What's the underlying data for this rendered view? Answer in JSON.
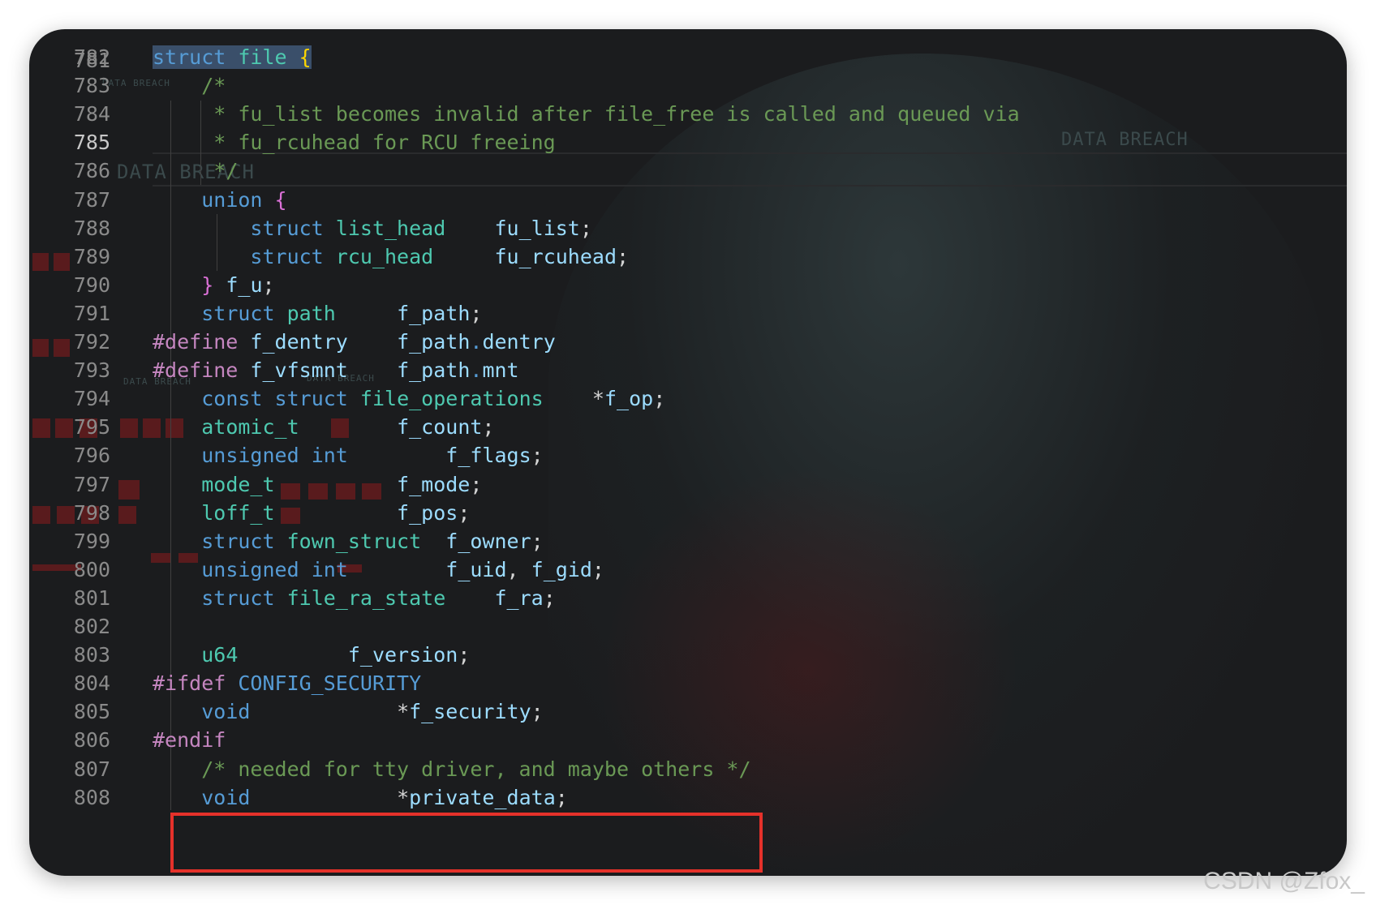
{
  "editor": {
    "partial_top_line": "781",
    "current_line": "785",
    "lines": [
      {
        "n": "782",
        "tokens": [
          [
            "kw sel",
            "struct"
          ],
          [
            "sel",
            " "
          ],
          [
            "ty sel",
            "file"
          ],
          [
            "sel",
            " "
          ],
          [
            "br sel",
            "{"
          ]
        ]
      },
      {
        "n": "783",
        "tokens": [
          [
            "",
            "    "
          ],
          [
            "cm",
            "/*"
          ]
        ]
      },
      {
        "n": "784",
        "tokens": [
          [
            "",
            "     "
          ],
          [
            "cm",
            "* fu_list becomes invalid after file_free is called and queued via"
          ]
        ]
      },
      {
        "n": "785",
        "tokens": [
          [
            "",
            "     "
          ],
          [
            "cm",
            "* fu_rcuhead for RCU freeing"
          ]
        ]
      },
      {
        "n": "786",
        "tokens": [
          [
            "",
            "     "
          ],
          [
            "cm",
            "*/"
          ]
        ]
      },
      {
        "n": "787",
        "tokens": [
          [
            "",
            "    "
          ],
          [
            "kw",
            "union"
          ],
          [
            "",
            " "
          ],
          [
            "br2",
            "{"
          ]
        ]
      },
      {
        "n": "788",
        "tokens": [
          [
            "",
            "        "
          ],
          [
            "kw",
            "struct"
          ],
          [
            "",
            " "
          ],
          [
            "ty",
            "list_head"
          ],
          [
            "",
            "    "
          ],
          [
            "id",
            "fu_list"
          ],
          [
            "pn",
            ";"
          ]
        ]
      },
      {
        "n": "789",
        "tokens": [
          [
            "",
            "        "
          ],
          [
            "kw",
            "struct"
          ],
          [
            "",
            " "
          ],
          [
            "ty",
            "rcu_head"
          ],
          [
            "",
            "     "
          ],
          [
            "id",
            "fu_rcuhead"
          ],
          [
            "pn",
            ";"
          ]
        ]
      },
      {
        "n": "790",
        "tokens": [
          [
            "",
            "    "
          ],
          [
            "br2",
            "}"
          ],
          [
            "",
            " "
          ],
          [
            "id",
            "f_u"
          ],
          [
            "pn",
            ";"
          ]
        ]
      },
      {
        "n": "791",
        "tokens": [
          [
            "",
            "    "
          ],
          [
            "kw",
            "struct"
          ],
          [
            "",
            " "
          ],
          [
            "ty",
            "path"
          ],
          [
            "",
            "     "
          ],
          [
            "id",
            "f_path"
          ],
          [
            "pn",
            ";"
          ]
        ]
      },
      {
        "n": "792",
        "tokens": [
          [
            "pp",
            "#define"
          ],
          [
            "",
            " "
          ],
          [
            "id",
            "f_dentry"
          ],
          [
            "",
            "    "
          ],
          [
            "id",
            "f_path"
          ],
          [
            "kw",
            "."
          ],
          [
            "id",
            "dentry"
          ]
        ]
      },
      {
        "n": "793",
        "tokens": [
          [
            "pp",
            "#define"
          ],
          [
            "",
            " "
          ],
          [
            "id",
            "f_vfsmnt"
          ],
          [
            "",
            "    "
          ],
          [
            "id",
            "f_path"
          ],
          [
            "kw",
            "."
          ],
          [
            "id",
            "mnt"
          ]
        ]
      },
      {
        "n": "794",
        "tokens": [
          [
            "",
            "    "
          ],
          [
            "kw",
            "const"
          ],
          [
            "",
            " "
          ],
          [
            "kw",
            "struct"
          ],
          [
            "",
            " "
          ],
          [
            "ty",
            "file_operations"
          ],
          [
            "",
            "    "
          ],
          [
            "pn",
            "*"
          ],
          [
            "id",
            "f_op"
          ],
          [
            "pn",
            ";"
          ]
        ]
      },
      {
        "n": "795",
        "tokens": [
          [
            "",
            "    "
          ],
          [
            "ty",
            "atomic_t"
          ],
          [
            "",
            "        "
          ],
          [
            "id",
            "f_count"
          ],
          [
            "pn",
            ";"
          ]
        ]
      },
      {
        "n": "796",
        "tokens": [
          [
            "",
            "    "
          ],
          [
            "kw",
            "unsigned"
          ],
          [
            "",
            " "
          ],
          [
            "kw",
            "int"
          ],
          [
            "",
            "        "
          ],
          [
            "id",
            "f_flags"
          ],
          [
            "pn",
            ";"
          ]
        ]
      },
      {
        "n": "797",
        "tokens": [
          [
            "",
            "    "
          ],
          [
            "ty",
            "mode_t"
          ],
          [
            "",
            "          "
          ],
          [
            "id",
            "f_mode"
          ],
          [
            "pn",
            ";"
          ]
        ]
      },
      {
        "n": "798",
        "tokens": [
          [
            "",
            "    "
          ],
          [
            "ty",
            "loff_t"
          ],
          [
            "",
            "          "
          ],
          [
            "id",
            "f_pos"
          ],
          [
            "pn",
            ";"
          ]
        ]
      },
      {
        "n": "799",
        "tokens": [
          [
            "",
            "    "
          ],
          [
            "kw",
            "struct"
          ],
          [
            "",
            " "
          ],
          [
            "ty",
            "fown_struct"
          ],
          [
            "",
            "  "
          ],
          [
            "id",
            "f_owner"
          ],
          [
            "pn",
            ";"
          ]
        ]
      },
      {
        "n": "800",
        "tokens": [
          [
            "",
            "    "
          ],
          [
            "kw",
            "unsigned"
          ],
          [
            "",
            " "
          ],
          [
            "kw",
            "int"
          ],
          [
            "",
            "        "
          ],
          [
            "id",
            "f_uid"
          ],
          [
            "pn",
            ", "
          ],
          [
            "id",
            "f_gid"
          ],
          [
            "pn",
            ";"
          ]
        ]
      },
      {
        "n": "801",
        "tokens": [
          [
            "",
            "    "
          ],
          [
            "kw",
            "struct"
          ],
          [
            "",
            " "
          ],
          [
            "ty",
            "file_ra_state"
          ],
          [
            "",
            "    "
          ],
          [
            "id",
            "f_ra"
          ],
          [
            "pn",
            ";"
          ]
        ]
      },
      {
        "n": "802",
        "tokens": []
      },
      {
        "n": "803",
        "tokens": [
          [
            "",
            "    "
          ],
          [
            "ty",
            "u64"
          ],
          [
            "",
            "         "
          ],
          [
            "id",
            "f_version"
          ],
          [
            "pn",
            ";"
          ]
        ]
      },
      {
        "n": "804",
        "tokens": [
          [
            "pp",
            "#ifdef"
          ],
          [
            "",
            " "
          ],
          [
            "kw",
            "CONFIG_SECURITY"
          ]
        ]
      },
      {
        "n": "805",
        "tokens": [
          [
            "",
            "    "
          ],
          [
            "kw",
            "void"
          ],
          [
            "",
            "            "
          ],
          [
            "pn",
            "*"
          ],
          [
            "id",
            "f_security"
          ],
          [
            "pn",
            ";"
          ]
        ]
      },
      {
        "n": "806",
        "tokens": [
          [
            "pp",
            "#endif"
          ]
        ]
      },
      {
        "n": "807",
        "tokens": [
          [
            "",
            "    "
          ],
          [
            "cm",
            "/* needed for tty driver, and maybe others */"
          ]
        ]
      },
      {
        "n": "808",
        "tokens": [
          [
            "",
            "    "
          ],
          [
            "kw",
            "void"
          ],
          [
            "",
            "            "
          ],
          [
            "pn",
            "*"
          ],
          [
            "id",
            "private_data"
          ],
          [
            "pn",
            ";"
          ]
        ]
      }
    ]
  },
  "background_text": {
    "a": "DATA BREACH",
    "b": "DATA BREACH",
    "c": "DATA BREACH",
    "d": "DATA BREACH",
    "e": "DATA BREACH"
  },
  "colors": {
    "highlight_box": "#e5312a",
    "background": "#1b1c1e"
  },
  "watermark": "CSDN @Zfox_"
}
